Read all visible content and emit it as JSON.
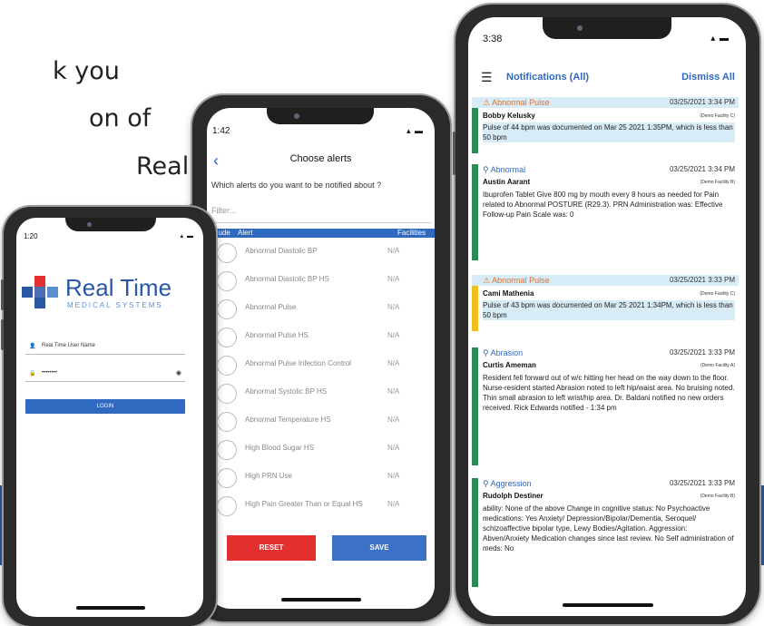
{
  "background": {
    "text_lines": [
      "k  you",
      "on of",
      "Real"
    ],
    "band_color": "#2a56a6"
  },
  "phone1": {
    "status_time": "1:20",
    "logo": {
      "name": "Real Time",
      "subtitle": "MEDICAL SYSTEMS",
      "color": "#2a56a6"
    },
    "username_placeholder": "Real Time User Name",
    "password_value": "••••••••",
    "login_label": "LOGIN"
  },
  "phone2": {
    "status_time": "1:42",
    "title": "Choose alerts",
    "question": "Which alerts do you want to be notified about ?",
    "filter_placeholder": "Filter...",
    "columns": {
      "include": "Include",
      "alert": "Alert",
      "facilities": "Facilities"
    },
    "alerts": [
      {
        "name": "Abnormal Diastolic BP",
        "facility": "N/A"
      },
      {
        "name": "Abnormal Diastolic BP HS",
        "facility": "N/A"
      },
      {
        "name": "Abnormal Pulse",
        "facility": "N/A"
      },
      {
        "name": "Abnormal Pulse HS",
        "facility": "N/A"
      },
      {
        "name": "Abnormal Pulse Infection Control",
        "facility": "N/A"
      },
      {
        "name": "Abnormal Systolic BP HS",
        "facility": "N/A"
      },
      {
        "name": "Abnormal Temperature HS",
        "facility": "N/A"
      },
      {
        "name": "High Blood Sugar HS",
        "facility": "N/A"
      },
      {
        "name": "High PRN Use",
        "facility": "N/A"
      },
      {
        "name": "High Pain Greater Than or Equal HS",
        "facility": "N/A"
      }
    ],
    "reset_label": "RESET",
    "save_label": "SAVE",
    "colors": {
      "reset": "#e53030",
      "save": "#3b72c6"
    }
  },
  "phone3": {
    "status_time": "3:38",
    "title": "Notifications (All)",
    "dismiss_label": "Dismiss All",
    "notifications": [
      {
        "type": "Abnormal Pulse",
        "date": "03/25/2021 3:34 PM",
        "patient": "Bobby Kelusky",
        "facility": "(Demo Facility C)",
        "body": "Pulse of 44 bpm was documented on Mar 25 2021 1:35PM, which is less than 50 bpm",
        "stripe": "#2e8b57",
        "highlight": "#d8ecf8"
      },
      {
        "type": "Abnormal",
        "date": "03/25/2021 3:34 PM",
        "patient": "Austin Aarant",
        "facility": "(Demo Facility B)",
        "body": "Ibuprofen Tablet Give 800 mg by mouth every 8 hours as needed for Pain related to Abnormal POSTURE (R29.3). PRN Administration was: Effective Follow-up Pain Scale was: 0",
        "stripe": "#2e8b57",
        "highlight": "#ffffff"
      },
      {
        "type": "Abnormal Pulse",
        "date": "03/25/2021 3:33 PM",
        "patient": "Cami Mathenia",
        "facility": "(Demo Facility C)",
        "body": "Pulse of 43 bpm was documented on Mar 25 2021 1:34PM, which is less than 50 bpm",
        "stripe": "#f0c020",
        "highlight": "#d8ecf8"
      },
      {
        "type": "Abrasion",
        "date": "03/25/2021 3:33 PM",
        "patient": "Curtis Ameman",
        "facility": "(Demo Facility A)",
        "body": "Resident fell forward out of w/c hitting her head on the way down to the floor. Nurse-resident started Abrasion noted to left hip/waist area. No bruising noted. Thin small abrasion to left wrist/hip area. Dr. Baldani notified no new orders received. Rick Edwards notified - 1:34 pm",
        "stripe": "#2e8b57",
        "highlight": "#ffffff"
      },
      {
        "type": "Aggression",
        "date": "03/25/2021 3:33 PM",
        "patient": "Rudolph Destiner",
        "facility": "(Demo Facility B)",
        "body": "ability: None of the above Change in cognitive status: No Psychoactive medications: Yes Anxiety/ Depression/Bipolar/Dementia, Seroquel/ schizoaffective bipolar type, Lewy Bodies/Agitation. Aggression: Abven/Anxiety Medication changes since last review. No Self administration of meds: No",
        "stripe": "#2e8b57",
        "highlight": "#ffffff"
      }
    ],
    "colors": {
      "link": "#2f69c0",
      "warning": "#e07030"
    }
  }
}
